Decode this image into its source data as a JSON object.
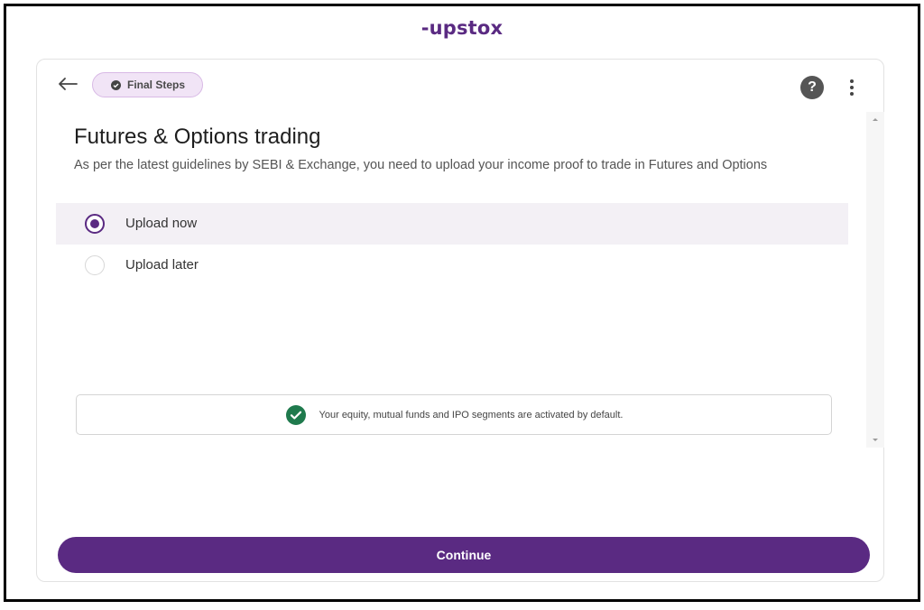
{
  "brand": {
    "logo_text": "-upstox"
  },
  "header": {
    "badge_label": "Final Steps",
    "badge_icon": "check-circle-icon",
    "back_icon": "arrow-left-icon",
    "help_label": "?",
    "more_icon": "more-vertical-icon"
  },
  "main": {
    "title": "Futures & Options trading",
    "subtitle": "As per the latest guidelines by SEBI & Exchange, you need to upload your income proof to trade in Futures and Options",
    "options": [
      {
        "label": "Upload now",
        "selected": true
      },
      {
        "label": "Upload later",
        "selected": false
      }
    ],
    "info_text": "Your equity, mutual funds and IPO segments are activated by default.",
    "info_icon": "check-circle-icon"
  },
  "footer": {
    "continue_label": "Continue"
  },
  "colors": {
    "accent": "#5a2a82",
    "success": "#1f7a4d",
    "badge_bg": "#f1e4f6"
  }
}
